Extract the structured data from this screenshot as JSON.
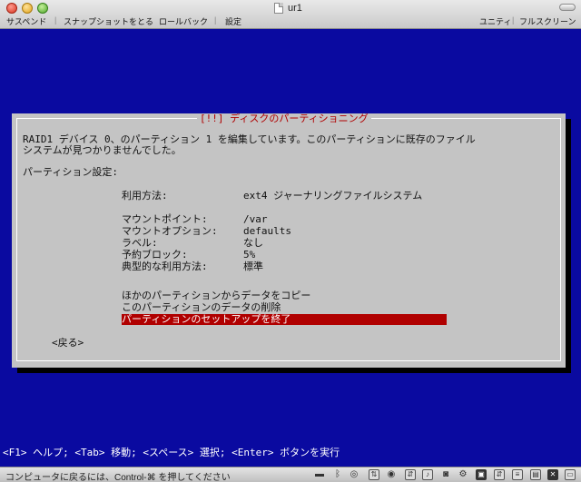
{
  "window": {
    "title": "ur1",
    "toolbar": {
      "suspend": "サスペンド",
      "snapshot": "スナップショットをとる",
      "rollback": "ロールバック",
      "settings": "設定",
      "unity": "ユニティ",
      "fullscreen": "フルスクリーン"
    }
  },
  "dialog": {
    "title": "[!!] ディスクのパーティショニング",
    "message_line1": "RAID1 デバイス 0、のパーティション 1 を編集しています。このパーティションに既存のファイル",
    "message_line2": "システムが見つかりませんでした。",
    "section_label": "パーティション設定:",
    "settings": [
      {
        "label": "利用方法:",
        "value": "ext4 ジャーナリングファイルシステム"
      },
      {
        "label": "マウントポイント:",
        "value": "/var"
      },
      {
        "label": "マウントオプション:",
        "value": "defaults"
      },
      {
        "label": "ラベル:",
        "value": "なし"
      },
      {
        "label": "予約ブロック:",
        "value": "5%"
      },
      {
        "label": "典型的な利用方法:",
        "value": "標準"
      }
    ],
    "actions": {
      "copy": "ほかのパーティションからデータをコピー",
      "delete": "このパーティションのデータの削除",
      "finish": "パーティションのセットアップを終了"
    },
    "back": "<戻る>"
  },
  "help_bar": "<F1> ヘルプ; <Tab> 移動; <スペース> 選択; <Enter> ボタンを実行",
  "statusbar": {
    "text": "コンピュータに戻るには、Control-⌘ を押してください"
  }
}
